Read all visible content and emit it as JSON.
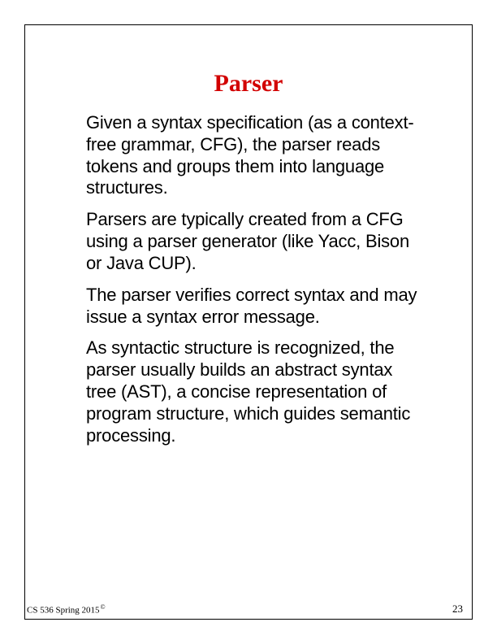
{
  "title": "Parser",
  "paragraphs": [
    "Given a syntax specification (as a context- free grammar, CFG), the parser reads tokens and groups them into language structures.",
    "Parsers are typically created from a CFG using a parser generator (like Yacc, Bison or Java CUP).",
    "The parser verifies correct syntax and may issue a syntax error message.",
    "As syntactic structure is recognized, the parser usually builds an abstract syntax tree (AST), a concise representation of program structure, which guides semantic processing."
  ],
  "footer": {
    "course": "CS 536  Spring 2015",
    "copyright": "©",
    "page": "23"
  }
}
